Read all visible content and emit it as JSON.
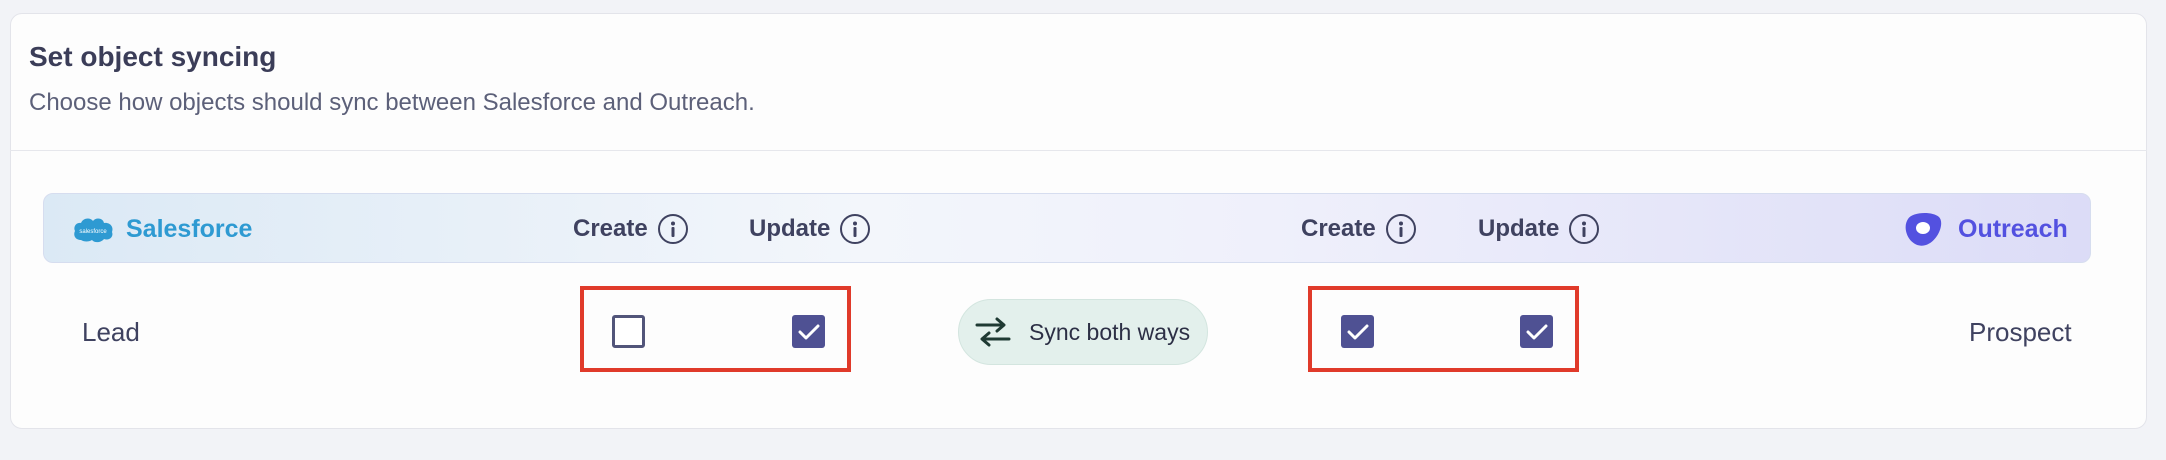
{
  "section": {
    "title": "Set object syncing",
    "subtitle": "Choose how objects should sync between Salesforce and Outreach."
  },
  "header": {
    "left_app": {
      "name": "Salesforce",
      "logo_text": "salesforce",
      "color": "#2e9ad2"
    },
    "right_app": {
      "name": "Outreach",
      "color": "#5351e0"
    },
    "left_columns": [
      "Create",
      "Update"
    ],
    "right_columns": [
      "Create",
      "Update"
    ]
  },
  "rows": [
    {
      "left_object": "Lead",
      "right_object": "Prospect",
      "left_create": false,
      "left_update": true,
      "right_create": true,
      "right_update": true,
      "sync_direction": "Sync both ways"
    }
  ],
  "colors": {
    "checkbox_checked": "#4f5193",
    "highlight_border": "#e03a2a",
    "sync_pill_bg": "#e3f0ec"
  }
}
